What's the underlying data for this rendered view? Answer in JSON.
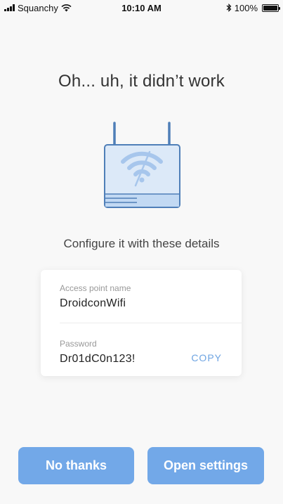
{
  "status_bar": {
    "carrier": "Squanchy",
    "time": "10:10 AM",
    "battery": "100%"
  },
  "title": "Oh... uh, it didn’t work",
  "subtitle": "Configure it with these details",
  "details": {
    "ssid_label": "Access point name",
    "ssid_value": "DroidconWifi",
    "password_label": "Password",
    "password_value": "Dr01dC0n123!",
    "copy_label": "COPY"
  },
  "actions": {
    "no_thanks": "No thanks",
    "open_settings": "Open settings"
  },
  "colors": {
    "accent": "#72a8e8",
    "router_stroke": "#4f7fb8",
    "router_fill": "#dce9f8"
  }
}
